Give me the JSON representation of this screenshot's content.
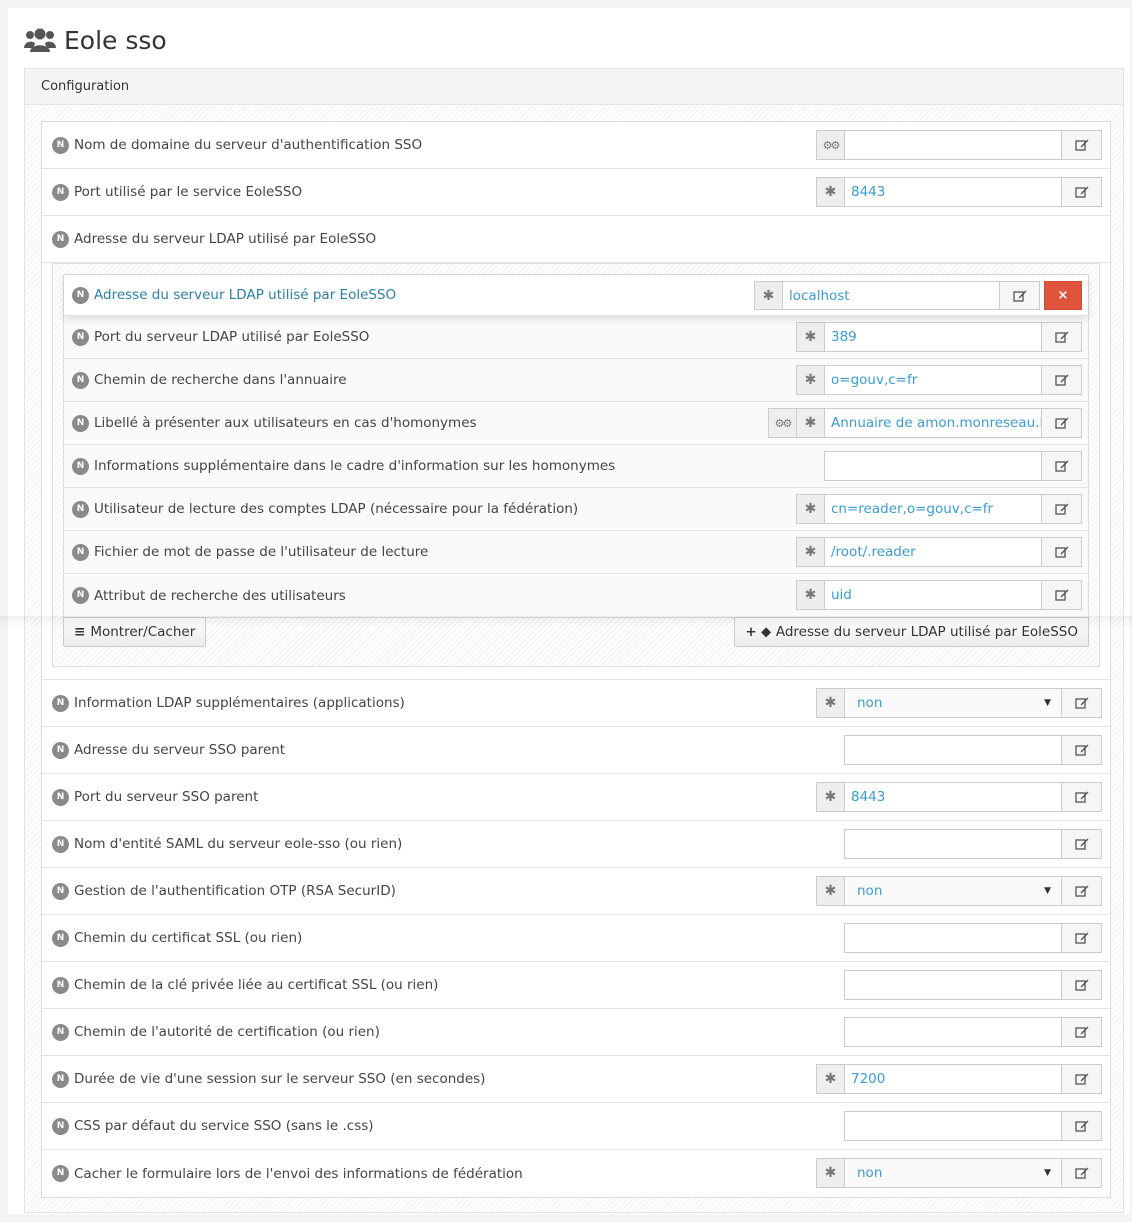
{
  "header": {
    "title": "Eole sso",
    "icon": "users-icon"
  },
  "panel": {
    "heading": "Configuration"
  },
  "colors": {
    "value_text": "#3a9bd6",
    "badge": "#8a8a8a",
    "delete": "#e0533c",
    "active_label": "#2b7fa3"
  },
  "badge_text": "N",
  "top_rows": [
    {
      "label": "Nom de domaine du serveur d'authentification SSO",
      "addons": [
        "gear-icon"
      ],
      "value": ""
    },
    {
      "label": "Port utilisé par le service EoleSSO",
      "addons": [
        "asterisk-icon"
      ],
      "value": "8443"
    }
  ],
  "ldap_group": {
    "label": "Adresse du serveur LDAP utilisé par EoleSSO",
    "entry": {
      "label": "Adresse du serveur LDAP utilisé par EoleSSO",
      "value": "localhost",
      "delete_symbol": "×"
    },
    "sub_rows": [
      {
        "label": "Port du serveur LDAP utilisé par EoleSSO",
        "addons": [
          "asterisk-icon"
        ],
        "value": "389"
      },
      {
        "label": "Chemin de recherche dans l'annuaire",
        "addons": [
          "asterisk-icon"
        ],
        "value": "o=gouv,c=fr"
      },
      {
        "label": "Libellé à présenter aux utilisateurs en cas d'homonymes",
        "addons": [
          "gear-icon",
          "asterisk-icon"
        ],
        "value": "Annuaire de amon.monreseau.lan"
      },
      {
        "label": "Informations supplémentaire dans le cadre d'information sur les homonymes",
        "addons": [],
        "value": ""
      },
      {
        "label": "Utilisateur de lecture des comptes LDAP (nécessaire pour la fédération)",
        "addons": [
          "asterisk-icon"
        ],
        "value": "cn=reader,o=gouv,c=fr"
      },
      {
        "label": "Fichier de mot de passe de l'utilisateur de lecture",
        "addons": [
          "asterisk-icon"
        ],
        "value": "/root/.reader"
      },
      {
        "label": "Attribut de recherche des utilisateurs",
        "addons": [
          "asterisk-icon"
        ],
        "value": "uid"
      }
    ],
    "show_hide_label": "Montrer/Cacher",
    "add_label": "Adresse du serveur LDAP utilisé par EoleSSO"
  },
  "bottom_rows": [
    {
      "label": "Information LDAP supplémentaires (applications)",
      "addons": [
        "asterisk-icon"
      ],
      "value": "non",
      "select": true
    },
    {
      "label": "Adresse du serveur SSO parent",
      "addons": [],
      "value": ""
    },
    {
      "label": "Port du serveur SSO parent",
      "addons": [
        "asterisk-icon"
      ],
      "value": "8443"
    },
    {
      "label": "Nom d'entité SAML du serveur eole-sso (ou rien)",
      "addons": [],
      "value": ""
    },
    {
      "label": "Gestion de l'authentification OTP (RSA SecurID)",
      "addons": [
        "asterisk-icon"
      ],
      "value": "non",
      "select": true
    },
    {
      "label": "Chemin du certificat SSL (ou rien)",
      "addons": [],
      "value": ""
    },
    {
      "label": "Chemin de la clé privée liée au certificat SSL (ou rien)",
      "addons": [],
      "value": ""
    },
    {
      "label": "Chemin de l'autorité de certification (ou rien)",
      "addons": [],
      "value": ""
    },
    {
      "label": "Durée de vie d'une session sur le serveur SSO (en secondes)",
      "addons": [
        "asterisk-icon"
      ],
      "value": "7200"
    },
    {
      "label": "CSS par défaut du service SSO (sans le .css)",
      "addons": [],
      "value": ""
    },
    {
      "label": "Cacher le formulaire lors de l'envoi des informations de fédération",
      "addons": [
        "asterisk-icon"
      ],
      "value": "non",
      "select": true
    }
  ]
}
